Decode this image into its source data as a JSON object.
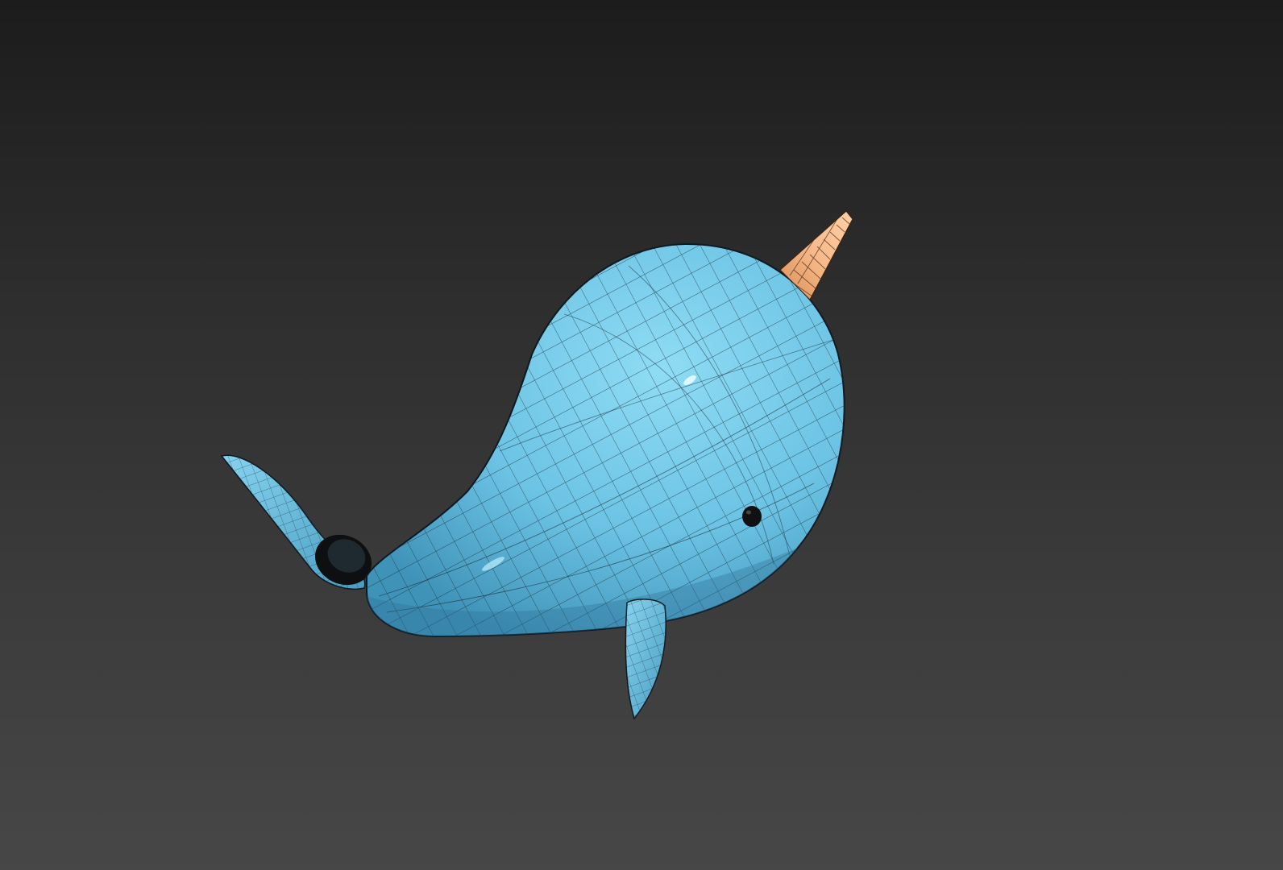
{
  "viewport": {
    "background_top": "#1c1c1c",
    "background_bottom": "#474747"
  },
  "model": {
    "body_color": "#72c8e6",
    "body_shadow_color": "#3d8fb5",
    "tusk_color": "#f2b27c",
    "wire_color": "#1a2a33",
    "eye_color": "#111111"
  }
}
